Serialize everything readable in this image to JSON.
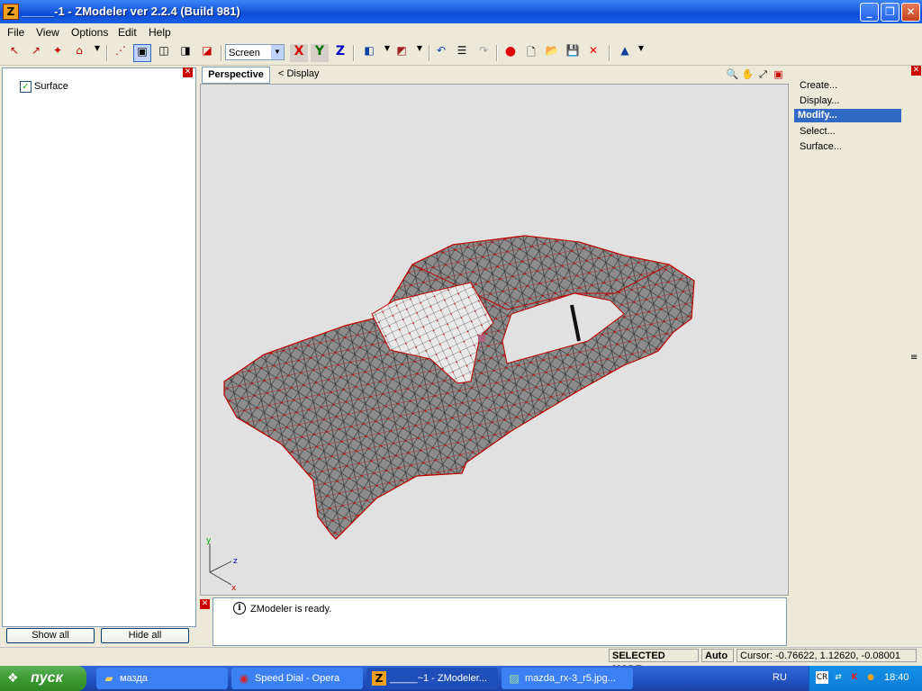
{
  "window": {
    "title": "_____-1 - ZModeler ver 2.2.4 (Build 981)",
    "icon_letter": "Z",
    "buttons": {
      "minimize": "_",
      "maximize": "❐",
      "close": "✕"
    }
  },
  "menu": [
    "File",
    "View",
    "Options",
    "Edit",
    "Help"
  ],
  "toolbar": {
    "coord_mode": "Screen",
    "axes": {
      "x": "X",
      "y": "Y",
      "z": "Z"
    },
    "colors": {
      "x": "#D00000",
      "y": "#007000",
      "z": "#0000C0"
    }
  },
  "left_panel": {
    "tree_items": [
      {
        "label": "Surface",
        "checked": true
      }
    ],
    "show_all": "Show all",
    "hide_all": "Hide all"
  },
  "viewport": {
    "tab": "Perspective",
    "display_label": "<  Display",
    "axes_labels": {
      "y": "y",
      "z": "z",
      "x": "x"
    }
  },
  "right_panel": {
    "items": [
      "Create...",
      "Display...",
      "Modify...",
      "Select...",
      "Surface..."
    ],
    "selected": "Modify..."
  },
  "log": {
    "message": "ZModeler is ready."
  },
  "status": {
    "mode": "SELECTED MODE",
    "snap": "Auto",
    "cursor": "Cursor: -0.76622, 1.12620, -0.08001"
  },
  "taskbar": {
    "start": "пуск",
    "tasks": [
      {
        "label": "мазда",
        "icon": "folder-icon"
      },
      {
        "label": "Speed Dial - Opera",
        "icon": "opera-icon"
      },
      {
        "label": "_____~1 - ZModeler...",
        "icon": "zmodeler-icon"
      },
      {
        "label": "mazda_rx-3_r5.jpg...",
        "icon": "image-icon"
      }
    ],
    "language": "RU",
    "clock": "18:40"
  },
  "mesh_color": "#D40000",
  "surface_color": "#8A8A8A"
}
